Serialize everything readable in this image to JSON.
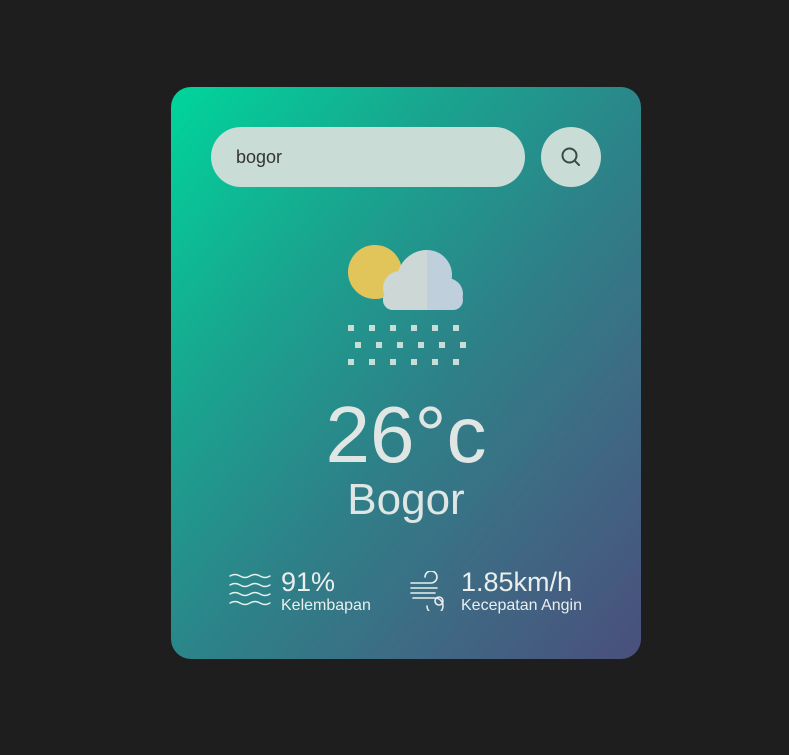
{
  "search": {
    "value": "bogor"
  },
  "weather": {
    "temperature": "26°c",
    "city": "Bogor"
  },
  "details": {
    "humidity": {
      "value": "91%",
      "label": "Kelembapan"
    },
    "wind": {
      "value": "1.85km/h",
      "label": "Kecepatan Angin"
    }
  },
  "icons": {
    "search": "search-icon",
    "weather": "snow-cloud-sun-icon",
    "humidity": "humidity-waves-icon",
    "wind": "wind-icon"
  },
  "colors": {
    "background": "#1e1e1e",
    "card_gradient_start": "#00d59b",
    "card_gradient_end": "#4a4f7c",
    "input_bg": "#c9dcd6",
    "text": "#dfe6e4"
  }
}
